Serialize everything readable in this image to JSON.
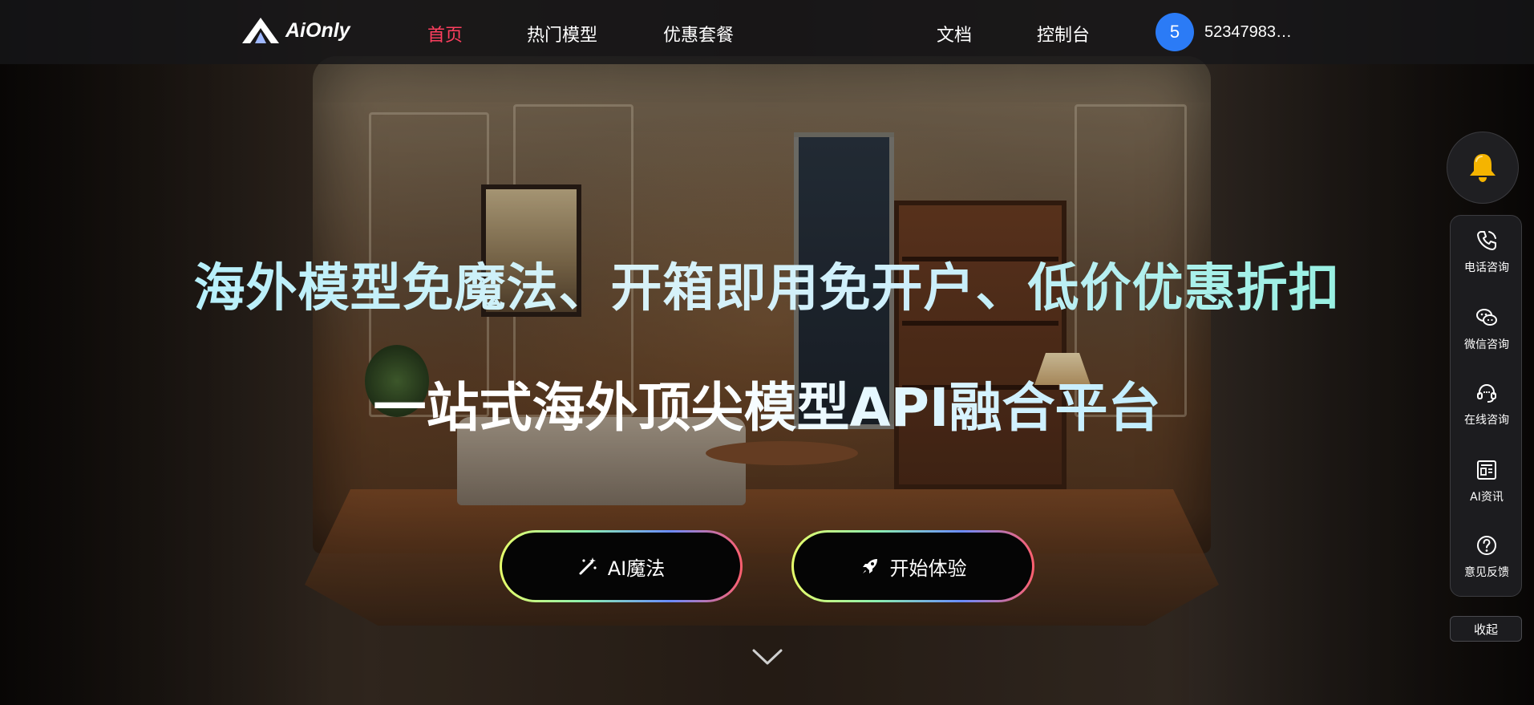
{
  "nav": {
    "logo_text": "AiOnly",
    "links": [
      {
        "label": "首页",
        "active": true
      },
      {
        "label": "热门模型",
        "active": false
      },
      {
        "label": "优惠套餐",
        "active": false
      },
      {
        "label": "文档",
        "active": false
      },
      {
        "label": "控制台",
        "active": false
      }
    ],
    "avatar_initial": "5",
    "username": "52347983…"
  },
  "hero": {
    "headline_1": "海外模型免魔法、开箱即用免开户、低价优惠折扣",
    "headline_2": "一站式海外顶尖模型API融合平台",
    "buttons": [
      {
        "label": "AI魔法",
        "icon": "magic-wand-icon"
      },
      {
        "label": "开始体验",
        "icon": "rocket-icon"
      }
    ],
    "scroll_icon": "chevron-down-icon"
  },
  "float_bar": {
    "bell_icon": "bell-icon",
    "items": [
      {
        "label": "电话咨询",
        "icon": "phone-icon"
      },
      {
        "label": "微信咨询",
        "icon": "wechat-icon"
      },
      {
        "label": "在线咨询",
        "icon": "headset-icon"
      },
      {
        "label": "AI资讯",
        "icon": "news-icon"
      },
      {
        "label": "意见反馈",
        "icon": "question-icon"
      }
    ],
    "collapse_label": "收起"
  },
  "colors": {
    "nav_active": "#ff3f5f",
    "avatar_bg": "#2b7bf6",
    "nav_bg": "#161618"
  }
}
